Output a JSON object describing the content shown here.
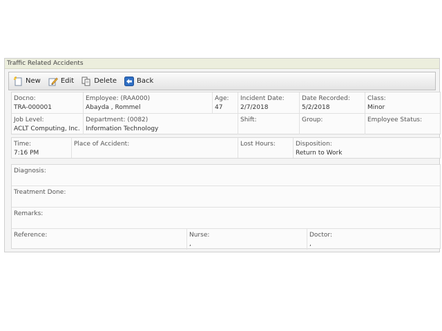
{
  "panel": {
    "title": "Traffic Related Accidents"
  },
  "toolbar": {
    "new_label": "New",
    "edit_label": "Edit",
    "delete_label": "Delete",
    "back_label": "Back"
  },
  "record": {
    "docno": {
      "label": "Docno:",
      "value": "TRA-000001"
    },
    "employee": {
      "label": "Employee: (RAA000)",
      "value": "Abayda , Rommel"
    },
    "age": {
      "label": "Age:",
      "value": "47"
    },
    "incident_date": {
      "label": "Incident Date:",
      "value": "2/7/2018"
    },
    "date_recorded": {
      "label": "Date Recorded:",
      "value": "5/2/2018"
    },
    "class": {
      "label": "Class:",
      "value": "Minor"
    },
    "job_level": {
      "label": "Job Level:",
      "value": "ACLT Computing, Inc."
    },
    "department": {
      "label": "Department: (0082)",
      "value": "Information Technology"
    },
    "shift": {
      "label": "Shift:",
      "value": ""
    },
    "group": {
      "label": "Group:",
      "value": ""
    },
    "employee_status": {
      "label": "Employee Status:",
      "value": ""
    },
    "time": {
      "label": "Time:",
      "value": "7:16 PM"
    },
    "place_of_accident": {
      "label": "Place of Accident:",
      "value": ""
    },
    "lost_hours": {
      "label": "Lost Hours:",
      "value": ""
    },
    "disposition": {
      "label": "Disposition:",
      "value": "Return to Work"
    },
    "diagnosis": {
      "label": "Diagnosis:",
      "value": ""
    },
    "treatment_done": {
      "label": "Treatment Done:",
      "value": ""
    },
    "remarks": {
      "label": "Remarks:",
      "value": ""
    },
    "reference": {
      "label": "Reference:",
      "value": ""
    },
    "nurse": {
      "label": "Nurse:",
      "value": ","
    },
    "doctor": {
      "label": "Doctor:",
      "value": ","
    }
  },
  "icons": {
    "new": "new-document-icon",
    "edit": "edit-pencil-icon",
    "delete": "delete-copy-icon",
    "back": "back-arrow-icon"
  }
}
